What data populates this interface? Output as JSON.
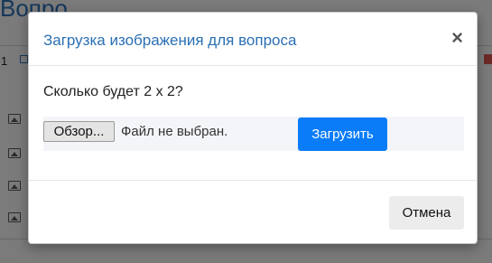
{
  "background": {
    "page_title": "Вопро",
    "row_number": "1"
  },
  "modal": {
    "title": "Загрузка изображения для вопроса",
    "close_label": "×",
    "question_text": "Сколько будет 2 x 2?",
    "browse_label": "Обзор...",
    "file_status": "Файл не выбран.",
    "upload_label": "Загрузить",
    "cancel_label": "Отмена"
  },
  "colors": {
    "title": "#2a6fb4",
    "primary_button": "#0a7cf8",
    "overlay": "rgba(0,0,0,0.5)"
  }
}
